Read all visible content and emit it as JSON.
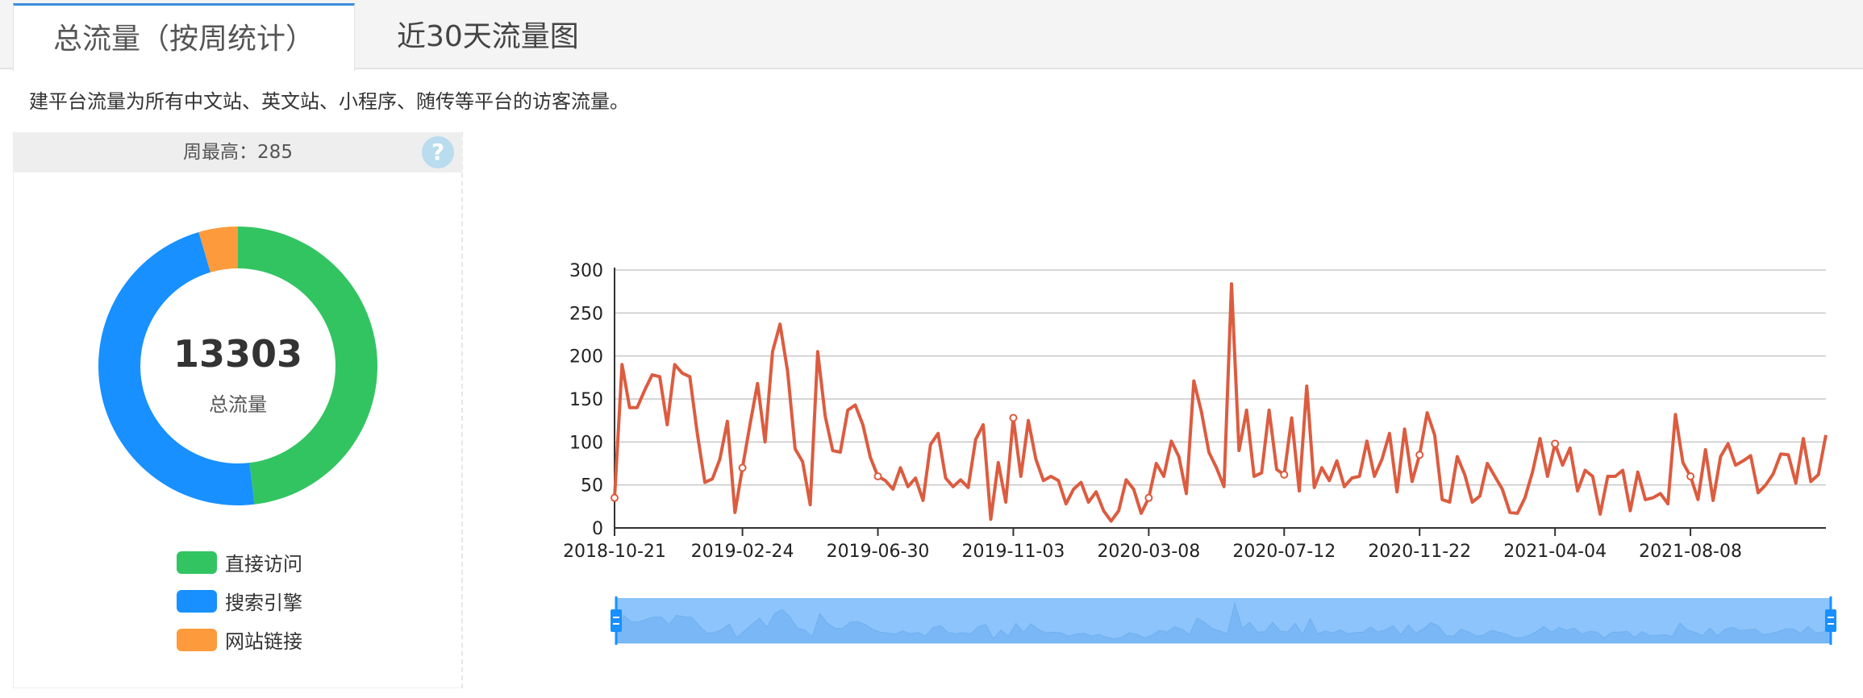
{
  "tabs": [
    {
      "label": "总流量（按周统计）",
      "active": true
    },
    {
      "label": "近30天流量图",
      "active": false
    }
  ],
  "description": "建平台流量为所有中文站、英文站、小程序、随传等平台的访客流量。",
  "summary": {
    "weekly_max_label": "周最高：285",
    "help_icon": "question-mark-icon",
    "help_symbol": "?"
  },
  "donut": {
    "total": "13303",
    "total_label": "总流量",
    "segments": [
      {
        "name": "直接访问",
        "value": 6400,
        "color": "#33c462"
      },
      {
        "name": "搜索引擎",
        "value": 6300,
        "color": "#1890ff"
      },
      {
        "name": "网站链接",
        "value": 603,
        "color": "#fd9b3c"
      }
    ]
  },
  "chart_data": {
    "type": "line",
    "title": "",
    "xlabel": "",
    "ylabel": "",
    "ylim": [
      0,
      300
    ],
    "y_ticks": [
      0,
      50,
      100,
      150,
      200,
      250,
      300
    ],
    "x_ticks": [
      "2018-10-21",
      "2019-02-24",
      "2019-06-30",
      "2019-11-03",
      "2020-03-08",
      "2020-07-12",
      "2020-11-22",
      "2021-04-04",
      "2021-08-08"
    ],
    "grid": true,
    "line_color": "#dc5c40",
    "series": [
      {
        "name": "",
        "values": [
          35,
          190,
          140,
          140,
          160,
          178,
          176,
          120,
          190,
          180,
          176,
          110,
          53,
          57,
          80,
          124,
          18,
          70,
          120,
          168,
          100,
          205,
          237,
          182,
          92,
          77,
          27,
          205,
          130,
          90,
          88,
          137,
          143,
          120,
          82,
          60,
          55,
          45,
          70,
          48,
          58,
          32,
          97,
          110,
          58,
          48,
          56,
          47,
          103,
          120,
          10,
          76,
          30,
          128,
          60,
          125,
          80,
          55,
          60,
          55,
          28,
          45,
          53,
          30,
          42,
          20,
          8,
          20,
          56,
          45,
          17,
          35,
          75,
          60,
          101,
          83,
          40,
          171,
          135,
          88,
          70,
          48,
          284,
          90,
          137,
          60,
          64,
          137,
          68,
          62,
          128,
          43,
          165,
          47,
          70,
          55,
          78,
          48,
          58,
          60,
          101,
          60,
          80,
          110,
          42,
          115,
          54,
          85,
          134,
          108,
          33,
          30,
          83,
          62,
          30,
          37,
          75,
          60,
          45,
          18,
          17,
          35,
          65,
          104,
          60,
          98,
          73,
          93,
          43,
          67,
          60,
          16,
          60,
          60,
          67,
          20,
          65,
          33,
          35,
          40,
          28,
          132,
          76,
          60,
          33,
          91,
          32,
          83,
          98,
          73,
          78,
          84,
          41,
          50,
          63,
          86,
          85,
          52,
          104,
          54,
          62,
          108
        ]
      }
    ],
    "highlight_points": [
      0,
      17,
      35,
      53,
      71,
      89,
      107,
      125,
      143
    ]
  },
  "scrollbar": {
    "handle_color": "#1890ff",
    "window_color": "#8cc4fb",
    "start_percent": 0,
    "end_percent": 100
  }
}
